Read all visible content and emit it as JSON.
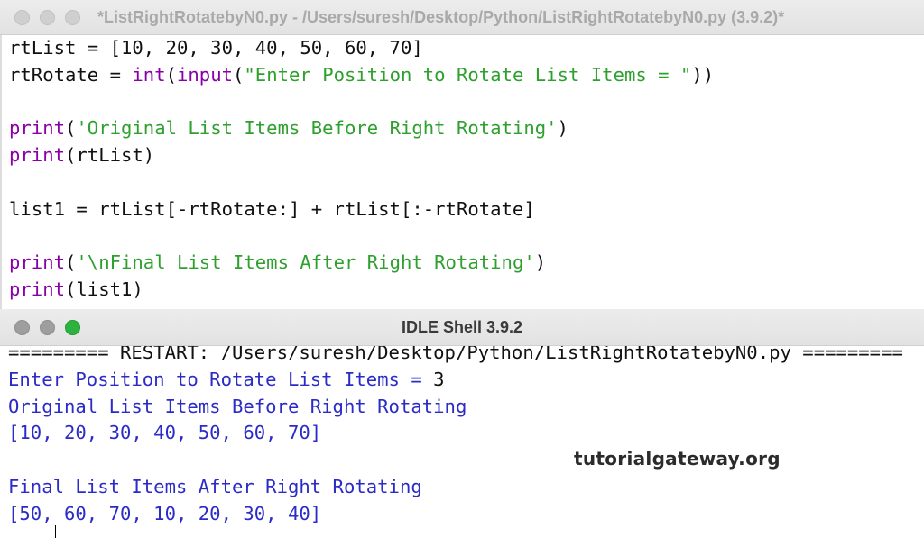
{
  "editor_window": {
    "title": "*ListRightRotatebyN0.py - /Users/suresh/Desktop/Python/ListRightRotatebyN0.py (3.9.2)*",
    "lines": [
      [
        {
          "t": "def",
          "s": "rtList = [10, 20, 30, 40, 50, 60, 70]"
        }
      ],
      [
        {
          "t": "def",
          "s": "rtRotate = "
        },
        {
          "t": "kw",
          "s": "int"
        },
        {
          "t": "def",
          "s": "("
        },
        {
          "t": "kw",
          "s": "input"
        },
        {
          "t": "def",
          "s": "("
        },
        {
          "t": "str",
          "s": "\"Enter Position to Rotate List Items = \""
        },
        {
          "t": "def",
          "s": "))"
        }
      ],
      [],
      [
        {
          "t": "kw",
          "s": "print"
        },
        {
          "t": "def",
          "s": "("
        },
        {
          "t": "str",
          "s": "'Original List Items Before Right Rotating'"
        },
        {
          "t": "def",
          "s": ")"
        }
      ],
      [
        {
          "t": "kw",
          "s": "print"
        },
        {
          "t": "def",
          "s": "(rtList)"
        }
      ],
      [],
      [
        {
          "t": "def",
          "s": "list1 = rtList[-rtRotate:] + rtList[:-rtRotate]"
        }
      ],
      [],
      [
        {
          "t": "kw",
          "s": "print"
        },
        {
          "t": "def",
          "s": "("
        },
        {
          "t": "str",
          "s": "'\\nFinal List Items After Right Rotating'"
        },
        {
          "t": "def",
          "s": ")"
        }
      ],
      [
        {
          "t": "kw",
          "s": "print"
        },
        {
          "t": "def",
          "s": "(list1)"
        }
      ]
    ]
  },
  "shell_window": {
    "title": "IDLE Shell 3.9.2",
    "lines": [
      [
        {
          "t": "def",
          "s": "========= RESTART: /Users/suresh/Desktop/Python/ListRightRotatebyN0.py ========="
        }
      ],
      [
        {
          "t": "out",
          "s": "Enter Position to Rotate List Items = "
        },
        {
          "t": "def",
          "s": "3"
        }
      ],
      [
        {
          "t": "out",
          "s": "Original List Items Before Right Rotating"
        }
      ],
      [
        {
          "t": "out",
          "s": "[10, 20, 30, 40, 50, 60, 70]"
        }
      ],
      [],
      [
        {
          "t": "out",
          "s": "Final List Items After Right Rotating"
        }
      ],
      [
        {
          "t": "out",
          "s": "[50, 60, 70, 10, 20, 30, 40]"
        }
      ]
    ]
  },
  "watermark": "tutorialgateway.org",
  "colors": {
    "keyword": "#8a00a8",
    "string": "#2ea02e",
    "output": "#2b2bc8",
    "close_active": "#2cb33e"
  }
}
